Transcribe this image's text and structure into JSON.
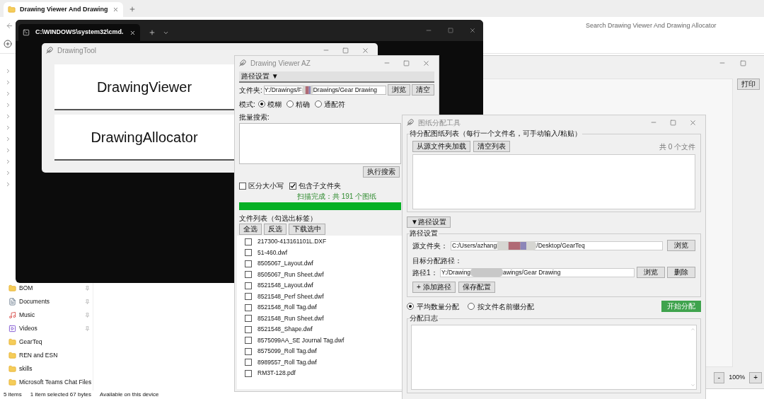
{
  "explorer": {
    "tab_title": "Drawing Viewer And Drawing",
    "search_placeholder": "Search Drawing Viewer And Drawing Allocator",
    "nav_items": [
      {
        "label": "BOM",
        "kind": "folder",
        "pinned": true
      },
      {
        "label": "Documents",
        "kind": "documents",
        "pinned": true
      },
      {
        "label": "Music",
        "kind": "music",
        "pinned": true
      },
      {
        "label": "Videos",
        "kind": "videos",
        "pinned": true
      },
      {
        "label": "GearTeq",
        "kind": "folder",
        "pinned": false
      },
      {
        "label": "REN and ESN",
        "kind": "folder",
        "pinned": false
      },
      {
        "label": "skills",
        "kind": "folder",
        "pinned": false
      },
      {
        "label": "Microsoft Teams Chat Files",
        "kind": "folder",
        "pinned": false
      }
    ],
    "status_bar": [
      "5 items",
      "1 item selected  67 bytes",
      "Available on this device"
    ]
  },
  "preview_window": {
    "print_button": "打印",
    "zoom_out": "-",
    "zoom_level": "100%",
    "zoom_in": "+"
  },
  "terminal": {
    "tab_title": "C:\\WINDOWS\\system32\\cmd."
  },
  "drawing_tool": {
    "title": "DrawingTool",
    "buttons": [
      "DrawingViewer",
      "DrawingAllocator"
    ]
  },
  "drawing_viewer": {
    "title": "Drawing Viewer AZ",
    "path_toggle": "路径设置 ▼",
    "folder_label": "文件夹:",
    "folder_value_start": "Y:/Drawings/F",
    "folder_value_end": "Drawings/Gear Drawing",
    "browse": "浏览",
    "clear": "清空",
    "mode_label": "模式:",
    "modes": [
      {
        "label": "模糊",
        "selected": true
      },
      {
        "label": "精确",
        "selected": false
      },
      {
        "label": "通配符",
        "selected": false
      }
    ],
    "batch_label": "批量搜索:",
    "search_button": "执行搜索",
    "options": [
      {
        "label": "区分大小写",
        "checked": false
      },
      {
        "label": "包含子文件夹",
        "checked": true
      }
    ],
    "scan_status": "扫描完成：共 191 个图纸",
    "progress": {
      "level": 1
    },
    "list_label": "文件列表（勾选出标签）",
    "list_buttons": [
      "全选",
      "反选",
      "下载选中"
    ],
    "files": [
      {
        "name": "217300-413161101L.DXF",
        "checked": false
      },
      {
        "name": "51-460.dwf",
        "checked": false
      },
      {
        "name": "8505067_Layout.dwf",
        "checked": false
      },
      {
        "name": "8505067_Run Sheet.dwf",
        "checked": false
      },
      {
        "name": "8521548_Layout.dwf",
        "checked": false
      },
      {
        "name": "8521548_Perf Sheet.dwf",
        "checked": false
      },
      {
        "name": "8521548_Roll Tag.dwf",
        "checked": false
      },
      {
        "name": "8521548_Run Sheet.dwf",
        "checked": false
      },
      {
        "name": "8521548_Shape.dwf",
        "checked": false
      },
      {
        "name": "8575099AA_SE Journal Tag.dwf",
        "checked": false
      },
      {
        "name": "8575099_Roll Tag.dwf",
        "checked": false
      },
      {
        "name": "8989557_Roll Tag.dwf",
        "checked": false
      },
      {
        "name": "RM3T-128.pdf",
        "checked": false
      }
    ]
  },
  "allocator": {
    "title": "图纸分配工具",
    "pending_group": "待分配图纸列表（每行一个文件名，可手动输入/粘贴）",
    "load_button": "从源文件夹加载",
    "clear_button": "清空列表",
    "file_count": "共 0 个文件",
    "path_toggle": "▼路径设置",
    "path_group": "路径设置",
    "source_label": "源文件夹：",
    "source_value_start": "C:/Users/azhang",
    "source_value_end": "/Desktop/GearTeq",
    "source_browse": "浏览",
    "target_label": "目标分配路径：",
    "target_paths": [
      {
        "label": "路径1：",
        "value_start": "Y:/Drawing",
        "value_end": "awings/Gear Drawing",
        "browse": "浏览",
        "delete": "删除"
      }
    ],
    "add_path": "+ 添加路径",
    "save_config": "保存配置",
    "methods": [
      {
        "label": "平均数量分配",
        "selected": true
      },
      {
        "label": "按文件名前缀分配",
        "selected": false
      }
    ],
    "start_button": "开始分配",
    "log_group": "分配日志"
  }
}
